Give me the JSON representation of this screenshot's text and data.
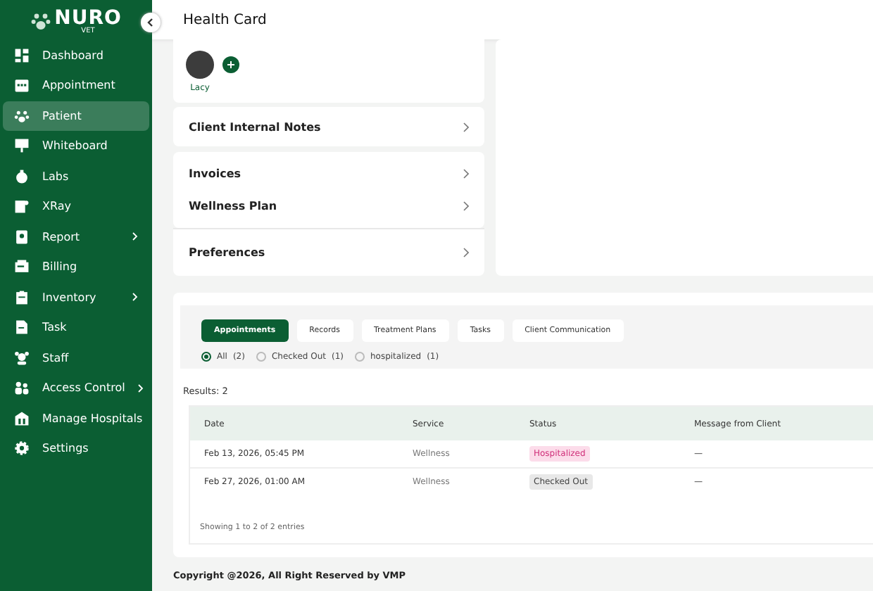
{
  "logo": {
    "title": "NURO",
    "subtitle": "VET"
  },
  "sidebar": {
    "items": [
      {
        "label": "Dashboard",
        "selected": false,
        "expandable": false
      },
      {
        "label": "Appointment",
        "selected": false,
        "expandable": false
      },
      {
        "label": "Patient",
        "selected": true,
        "expandable": false
      },
      {
        "label": "Whiteboard",
        "selected": false,
        "expandable": false
      },
      {
        "label": "Labs",
        "selected": false,
        "expandable": false
      },
      {
        "label": "XRay",
        "selected": false,
        "expandable": false
      },
      {
        "label": "Report",
        "selected": false,
        "expandable": true
      },
      {
        "label": "Billing",
        "selected": false,
        "expandable": false
      },
      {
        "label": "Inventory",
        "selected": false,
        "expandable": true
      },
      {
        "label": "Task",
        "selected": false,
        "expandable": false
      },
      {
        "label": "Staff",
        "selected": false,
        "expandable": false
      },
      {
        "label": "Access Control",
        "selected": false,
        "expandable": true
      },
      {
        "label": "Manage Hospitals",
        "selected": false,
        "expandable": false
      },
      {
        "label": "Settings",
        "selected": false,
        "expandable": false
      }
    ]
  },
  "header": {
    "title": "Health Card"
  },
  "pets": [
    {
      "name": "Lacy"
    }
  ],
  "menu_groups": [
    [
      "Client Internal Notes"
    ],
    [
      "Invoices",
      "Wellness Plan"
    ],
    [
      "Preferences"
    ]
  ],
  "tabs": [
    {
      "label": "Appointments",
      "selected": true
    },
    {
      "label": "Records",
      "selected": false
    },
    {
      "label": "Treatment Plans",
      "selected": false
    },
    {
      "label": "Tasks",
      "selected": false
    },
    {
      "label": "Client Communication",
      "selected": false
    }
  ],
  "filters": [
    {
      "label": "All",
      "count": "(2)",
      "selected": true
    },
    {
      "label": "Checked Out",
      "count": "(1)",
      "selected": false
    },
    {
      "label": "hospitalized",
      "count": "(1)",
      "selected": false
    }
  ],
  "results": "Results: 2",
  "table": {
    "columns": [
      "Date",
      "Service",
      "Status",
      "Message from Client"
    ],
    "rows": [
      {
        "date": "Feb 13, 2026, 05:45 PM",
        "service": "Wellness",
        "status": "Hospitalized",
        "kind": "hospitalized",
        "message": "—"
      },
      {
        "date": "Feb 27, 2026, 01:00 AM",
        "service": "Wellness",
        "status": "Checked Out",
        "kind": "checked-out",
        "message": "—"
      }
    ]
  },
  "pagination": "Showing 1 to 2 of 2 entries",
  "footer": "Copyright @2026, All Right Reserved by VMP"
}
